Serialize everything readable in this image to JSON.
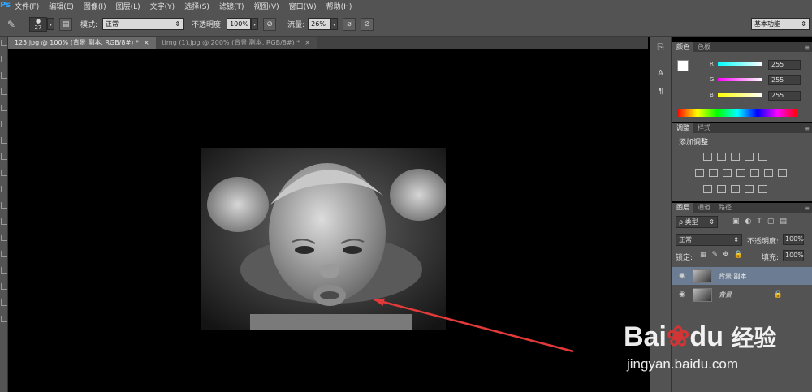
{
  "app": {
    "logo": "Ps"
  },
  "menus": [
    "文件(F)",
    "编辑(E)",
    "图像(I)",
    "图层(L)",
    "文字(Y)",
    "选择(S)",
    "滤镜(T)",
    "视图(V)",
    "窗口(W)",
    "帮助(H)"
  ],
  "options": {
    "brush_size": "27",
    "mode_label": "模式:",
    "mode_value": "正常",
    "opacity_label": "不透明度:",
    "opacity_value": "100%",
    "flow_label": "流量:",
    "flow_value": "26%",
    "workspace": "基本功能"
  },
  "tabs": [
    {
      "label": "125.jpg @ 100% (背景 副本, RGB/8#) *",
      "close": "×"
    },
    {
      "label": "timg (1).jpg @ 200% (背景 副本, RGB/8#) *",
      "close": "×"
    }
  ],
  "color_panel": {
    "tabs": [
      "颜色",
      "色板"
    ],
    "channels": [
      {
        "name": "R",
        "value": "255",
        "color": "#ff3030"
      },
      {
        "name": "G",
        "value": "255",
        "color": "#30ff30"
      },
      {
        "name": "B",
        "value": "255",
        "color": "#3030ff"
      }
    ]
  },
  "adjust_panel": {
    "tabs": [
      "调整",
      "样式"
    ],
    "title": "添加调整"
  },
  "layers_panel": {
    "tabs": [
      "图层",
      "通道",
      "路径"
    ],
    "filter_label": "ρ 类型",
    "blend_mode": "正常",
    "opacity_label": "不透明度:",
    "opacity_value": "100%",
    "lock_label": "锁定:",
    "fill_label": "填充:",
    "fill_value": "100%",
    "layers": [
      {
        "name": "背景 副本",
        "selected": true
      },
      {
        "name": "背景",
        "selected": false
      }
    ]
  },
  "watermark": {
    "brand": "Bai",
    "brand2": "du",
    "product": "经验",
    "url": "jingyan.baidu.com"
  },
  "annotation_color": "#e23a3a"
}
